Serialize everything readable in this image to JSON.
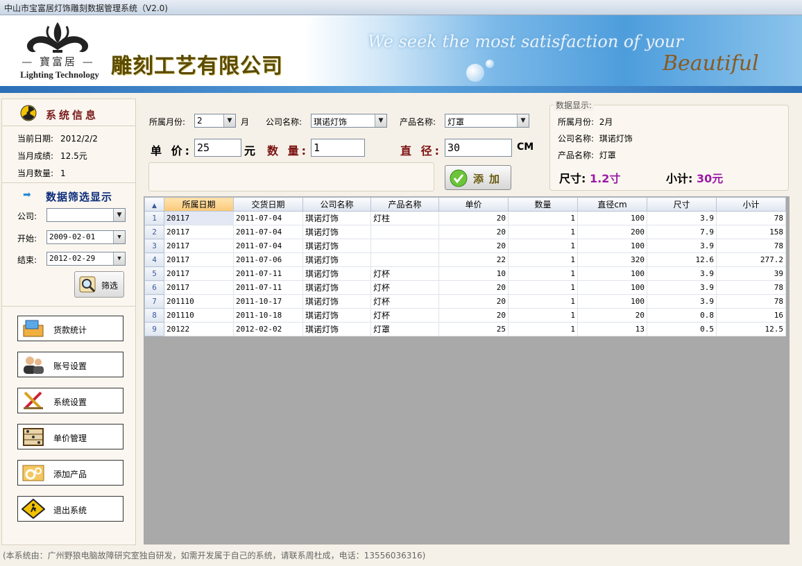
{
  "window": {
    "title": "中山市宝富居灯饰雕刻数据管理系统（V2.0)"
  },
  "banner": {
    "logo_chars": "寶富居",
    "logo_sub": "Lighting Technology",
    "company": "雕刻工艺有限公司",
    "slogan": "We seek the most satisfaction of your",
    "beautiful": "Beautiful"
  },
  "system_info": {
    "title": "系统信息",
    "date_label": "当前日期:",
    "date_value": "2012/2/2",
    "perf_label": "当月成绩:",
    "perf_value": "12.5元",
    "qty_label": "当月数量:",
    "qty_value": "1"
  },
  "filter": {
    "title": "数据筛选显示",
    "company_label": "公司:",
    "company_value": "",
    "start_label": "开始:",
    "start_value": "2009-02-01",
    "end_label": "结束:",
    "end_value": "2012-02-29",
    "button": "筛选"
  },
  "nav": [
    {
      "label": "货款统计",
      "icon": "payment-icon"
    },
    {
      "label": "账号设置",
      "icon": "users-icon"
    },
    {
      "label": "系统设置",
      "icon": "tools-icon"
    },
    {
      "label": "单价管理",
      "icon": "abacus-icon"
    },
    {
      "label": "添加产品",
      "icon": "gears-icon"
    },
    {
      "label": "退出系统",
      "icon": "exit-sign-icon"
    }
  ],
  "form": {
    "month_label": "所属月份:",
    "month_value": "2",
    "month_unit": "月",
    "company_label": "公司名称:",
    "company_value": "琪诺灯饰",
    "product_label": "产品名称:",
    "product_value": "灯罩",
    "price_label": "单 价:",
    "price_value": "25",
    "price_unit": "元",
    "qty_label": "数 量:",
    "qty_value": "1",
    "diam_label": "直 径:",
    "diam_value": "30",
    "diam_unit": "CM",
    "add_button": "添加"
  },
  "display": {
    "legend": "数据显示:",
    "month_label": "所属月份:",
    "month_value": "2月",
    "company_label": "公司名称:",
    "company_value": "琪诺灯饰",
    "product_label": "产品名称:",
    "product_value": "灯罩",
    "size_label": "尺寸:",
    "size_value": "1.2寸",
    "subtotal_label": "小计:",
    "subtotal_value": "30元"
  },
  "grid": {
    "columns": [
      "所属日期",
      "交货日期",
      "公司名称",
      "产品名称",
      "单价",
      "数量",
      "直径cm",
      "尺寸",
      "小计"
    ],
    "rows": [
      [
        "1",
        "20117",
        "2011-07-04",
        "琪诺灯饰",
        "灯柱",
        "20",
        "1",
        "100",
        "3.9",
        "78"
      ],
      [
        "2",
        "20117",
        "2011-07-04",
        "琪诺灯饰",
        "",
        "20",
        "1",
        "200",
        "7.9",
        "158"
      ],
      [
        "3",
        "20117",
        "2011-07-04",
        "琪诺灯饰",
        "",
        "20",
        "1",
        "100",
        "3.9",
        "78"
      ],
      [
        "4",
        "20117",
        "2011-07-06",
        "琪诺灯饰",
        "",
        "22",
        "1",
        "320",
        "12.6",
        "277.2"
      ],
      [
        "5",
        "20117",
        "2011-07-11",
        "琪诺灯饰",
        "灯杯",
        "10",
        "1",
        "100",
        "3.9",
        "39"
      ],
      [
        "6",
        "20117",
        "2011-07-11",
        "琪诺灯饰",
        "灯杯",
        "20",
        "1",
        "100",
        "3.9",
        "78"
      ],
      [
        "7",
        "201110",
        "2011-10-17",
        "琪诺灯饰",
        "灯杯",
        "20",
        "1",
        "100",
        "3.9",
        "78"
      ],
      [
        "8",
        "201110",
        "2011-10-18",
        "琪诺灯饰",
        "灯杯",
        "20",
        "1",
        "20",
        "0.8",
        "16"
      ],
      [
        "9",
        "20122",
        "2012-02-02",
        "琪诺灯饰",
        "灯罩",
        "25",
        "1",
        "13",
        "0.5",
        "12.5"
      ]
    ]
  },
  "footer": "(本系统由：广州野狼电脑故障研究室独自研发，如需开发属于自己的系统，请联系周杜成，电话：13556036316)"
}
